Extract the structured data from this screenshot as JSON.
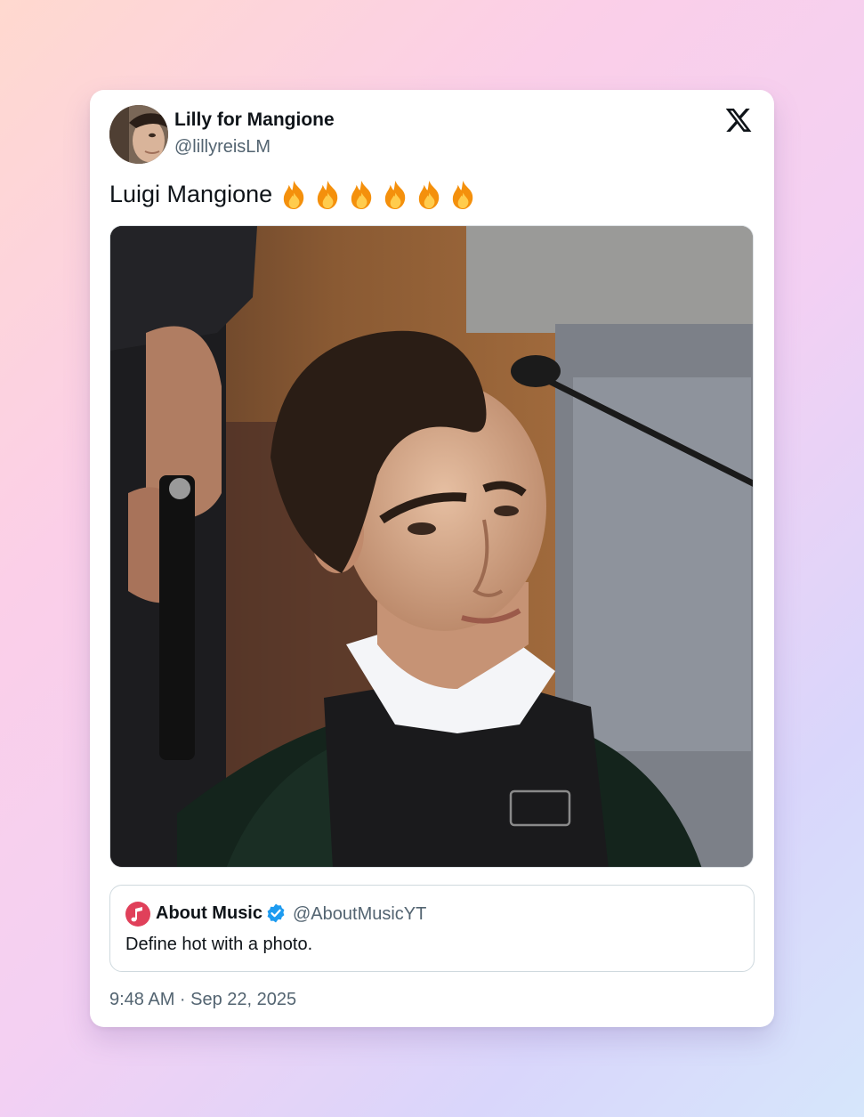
{
  "tweet": {
    "author_name": "Lilly for Mangione",
    "author_handle": "@lillyreisLM",
    "text": "Luigi Mangione",
    "emoji": [
      "fire",
      "fire",
      "fire",
      "fire",
      "fire",
      "fire"
    ],
    "brand_icon": "x-logo-icon",
    "timestamp": "9:48 AM · Sep 22, 2025"
  },
  "quoted_tweet": {
    "author_name": "About Music",
    "author_handle": "@AboutMusicYT",
    "verified": true,
    "text": "Define hot with a photo.",
    "avatar_icon": "music-note-icon"
  },
  "colors": {
    "text_primary": "#0f1419",
    "text_secondary": "#536471",
    "verified_blue": "#1d9bf0",
    "quote_border": "#cfd9de",
    "music_avatar": "#e0405a"
  }
}
